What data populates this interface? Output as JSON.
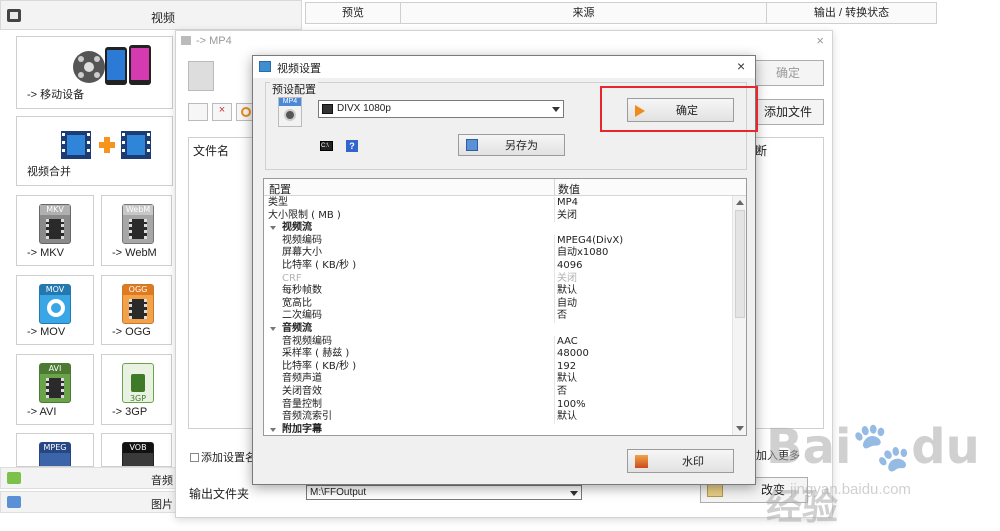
{
  "left_panel": {
    "header_title": "视频",
    "tiles": [
      {
        "id": "mobile",
        "label": "-> 移动设备"
      },
      {
        "id": "merge",
        "label": "视频合并"
      },
      {
        "id": "mkv",
        "label": "-> MKV",
        "badge": "MKV"
      },
      {
        "id": "webm",
        "label": "-> WebM",
        "badge": "WebM"
      },
      {
        "id": "mov",
        "label": "-> MOV",
        "badge": "MOV"
      },
      {
        "id": "ogg",
        "label": "-> OGG",
        "badge": "OGG"
      },
      {
        "id": "avi",
        "label": "-> AVI",
        "badge": "AVI"
      },
      {
        "id": "3gp",
        "label": "-> 3GP",
        "badge": "3GP"
      },
      {
        "id": "mpeg",
        "label": "",
        "badge": "MPEG"
      },
      {
        "id": "vob",
        "label": "",
        "badge": "VOB"
      }
    ],
    "footer_audio": "音频",
    "footer_picture": "图片"
  },
  "grid_header": {
    "preview": "预览",
    "source": "来源",
    "output_status": "输出 / 转换状态"
  },
  "bg_dialog": {
    "caption": "-> MP4",
    "close": "×",
    "ok_button": "确定",
    "add_file_button": "添加文件",
    "file_name_header": "文件名",
    "partial_header": "断",
    "add_settings_checkbox": "添加设置名称",
    "add_more_checkbox": "加入更多",
    "output_folder_label": "输出文件夹",
    "output_folder_value": "M:\\FFOutput",
    "change_button": "改变"
  },
  "settings_dialog": {
    "title": "视频设置",
    "close": "×",
    "preset_group": "预设配置",
    "preset_value": "DIVX 1080p",
    "mp4_badge": "MP4",
    "confirm_button": "确定",
    "save_as_button": "另存为",
    "watermark_button": "水印",
    "grid": {
      "col_config": "配置",
      "col_value": "数值",
      "rows": [
        {
          "type": "prop",
          "name": "类型",
          "value": "MP4"
        },
        {
          "type": "prop",
          "name": "大小限制 ( MB )",
          "value": "关闭"
        },
        {
          "type": "cat",
          "name": "视频流",
          "value": ""
        },
        {
          "type": "sub",
          "name": "视频编码",
          "value": "MPEG4(DivX)"
        },
        {
          "type": "sub",
          "name": "屏幕大小",
          "value": "自动x1080"
        },
        {
          "type": "sub",
          "name": "比特率 ( KB/秒 )",
          "value": "4096"
        },
        {
          "type": "sub-disabled",
          "name": "CRF",
          "value": "关闭"
        },
        {
          "type": "sub",
          "name": "每秒帧数",
          "value": "默认"
        },
        {
          "type": "sub",
          "name": "宽高比",
          "value": "自动"
        },
        {
          "type": "sub",
          "name": "二次编码",
          "value": "否"
        },
        {
          "type": "cat",
          "name": "音频流",
          "value": ""
        },
        {
          "type": "sub",
          "name": "音视频编码",
          "value": "AAC"
        },
        {
          "type": "sub",
          "name": "采样率 ( 赫兹 )",
          "value": "48000"
        },
        {
          "type": "sub",
          "name": "比特率 ( KB/秒 )",
          "value": "192"
        },
        {
          "type": "sub",
          "name": "音频声道",
          "value": "默认"
        },
        {
          "type": "sub",
          "name": "关闭音效",
          "value": "否"
        },
        {
          "type": "sub",
          "name": "音量控制",
          "value": "100%"
        },
        {
          "type": "sub",
          "name": "音频流索引",
          "value": "默认"
        },
        {
          "type": "cat",
          "name": "附加字幕",
          "value": ""
        }
      ]
    }
  },
  "watermark": {
    "brand": "Bai",
    "brand2": "du",
    "brand_cn": "经验",
    "url": "jingyan.baidu.com"
  },
  "colors": {
    "highlight": "#e8262d",
    "accent_blue": "#3f8fd0"
  }
}
